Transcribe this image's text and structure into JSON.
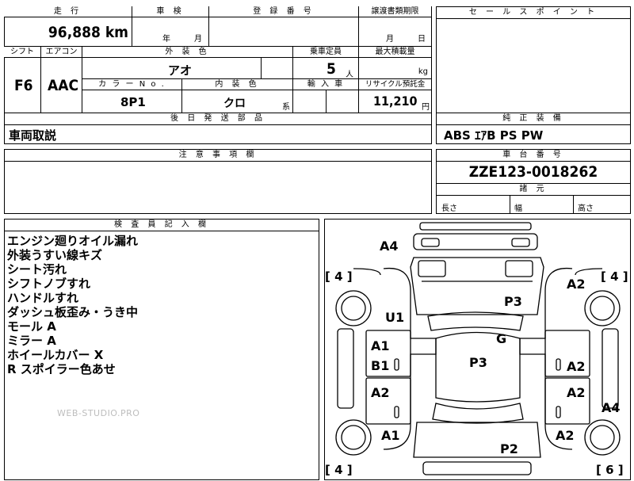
{
  "headers": {
    "mileage": "走 行",
    "inspection": "車 検",
    "registration_no": "登 録 番 号",
    "transfer_deadline": "譲渡書類期限",
    "sales_point": "セ ー ル ス ポ イ ン ト",
    "shift": "シフト",
    "aircon": "エアコン",
    "exterior_color": "外 装 色",
    "capacity": "乗車定員",
    "max_load": "最大積載量",
    "color_no": "カ ラ ー N o .",
    "interior_color": "内 装 色",
    "import": "輸 入 車",
    "recycle_fee": "リサイクル預託金",
    "later_parts": "後 日 発 送 部 品",
    "standard_equipment": "純 正 装 備",
    "caution": "注 意 事 項 欄",
    "chassis_no": "車 台 番 号",
    "dimensions": "諸 元",
    "inspector_notes": "検 査 員 記 入 欄"
  },
  "values": {
    "mileage": "96,888 km",
    "inspection_year": "年",
    "inspection_month": "月",
    "transfer_month": "月",
    "transfer_day": "日",
    "shift": "F6",
    "aircon": "AAC",
    "exterior_color": "アオ",
    "capacity": "5",
    "capacity_unit": "人",
    "max_load_unit": "kg",
    "color_no": "8P1",
    "interior_color": "クロ",
    "interior_suffix": "系",
    "recycle_fee": "11,210",
    "recycle_unit": "円",
    "later_parts": "車両取説",
    "standard_equipment": "ABS ｴｱB PS PW",
    "chassis_no": "ZZE123-0018262",
    "length": "長さ",
    "width": "幅",
    "height": "高さ"
  },
  "inspector_notes": [
    "エンジン廻りオイル漏れ",
    "外装うすい線キズ",
    "シート汚れ",
    "シフトノブすれ",
    "ハンドルすれ",
    "ダッシュ板歪み・うき中",
    "モール A",
    "ミラー A",
    "ホイールカバー X",
    "R スポイラー色あせ"
  ],
  "watermark": "WEB-STUDIO.PRO",
  "diagram_marks": {
    "a4_top": "A4",
    "u1": "U1",
    "p3_top": "P3",
    "a2_right_top": "A2",
    "g": "G",
    "p3_mid": "P3",
    "a1_left": "A1",
    "b1_left": "B1",
    "a2_right_mid": "A2",
    "a2_left_low": "A2",
    "a2_right_low": "A2",
    "a4_right": "A4",
    "a1_left_bottom": "A1",
    "a2_right_bottom": "A2",
    "p2": "P2",
    "tire_fl": "[ 4 ]",
    "tire_fr": "[ 4 ]",
    "tire_rl": "[ 4 ]",
    "tire_rr": "[ 6 ]"
  }
}
